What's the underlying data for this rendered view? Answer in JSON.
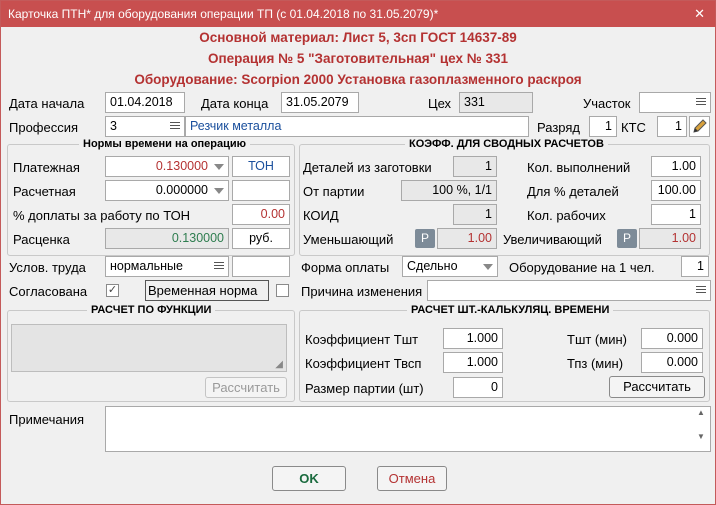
{
  "window": {
    "title": "Карточка ПТН* для оборудования операции ТП (с 01.04.2018 по 31.05.2079)*",
    "close_glyph": "✕"
  },
  "header": {
    "material": "Основной материал: Лист 5, 3сп ГОСТ 14637-89",
    "operation": "Операция № 5 \"Заготовительная\"  цех № 331",
    "equipment": "Оборудование: Scorpion 2000 Установка газоплазменного раскроя"
  },
  "fields": {
    "date_start_label": "Дата начала",
    "date_start": "01.04.2018",
    "date_end_label": "Дата конца",
    "date_end": "31.05.2079",
    "shop_label": "Цех",
    "shop": "331",
    "area_label": "Участок",
    "area": "",
    "profession_label": "Профессия",
    "profession_code": "3",
    "profession_name": "Резчик металла",
    "grade_label": "Разряд",
    "grade": "1",
    "kts_label": "КТС",
    "kts": "1"
  },
  "norms": {
    "title": "Нормы времени на операцию",
    "payable_label": "Платежная",
    "payable": "0.130000",
    "payable_unit": "ТОН",
    "calc_label": "Расчетная",
    "calc": "0.000000",
    "calc_unit": "",
    "ton_pct_label": "% доплаты за работу по ТОН",
    "ton_pct": "0.00",
    "rate_label": "Расценка",
    "rate": "0.130000",
    "rate_unit": "руб."
  },
  "coef": {
    "title": "КОЭФФ. ДЛЯ СВОДНЫХ РАСЧЕТОВ",
    "parts_label": "Деталей из заготовки",
    "parts": "1",
    "exec_label": "Кол. выполнений",
    "exec": "1.00",
    "batch_label": "От партии",
    "batch": "100 %, 1/1",
    "pct_label": "Для % деталей",
    "pct": "100.00",
    "koid_label": "КОИД",
    "koid": "1",
    "workers_label": "Кол. рабочих",
    "workers": "1",
    "dec_label": "Уменьшающий",
    "dec_badge": "Р",
    "dec": "1.00",
    "inc_label": "Увеличивающий",
    "inc_badge": "Р",
    "inc": "1.00"
  },
  "conditions": {
    "work_label": "Услов. труда",
    "work": "нормальные",
    "pay_form_label": "Форма оплаты",
    "pay_form": "Сдельно",
    "equip_per_label": "Оборудование на 1 чел.",
    "equip_per": "1",
    "agreed_label": "Согласована",
    "agreed_mark": "✓",
    "temp_label": "Временная норма",
    "reason_label": "Причина изменения",
    "reason": ""
  },
  "func_calc": {
    "title": "РАСЧЕТ ПО ФУНКЦИИ",
    "button": "Рассчитать"
  },
  "time_calc": {
    "title": "РАСЧЕТ ШТ.-КАЛЬКУЛЯЦ. ВРЕМЕНИ",
    "k_tsht_label": "Коэффициент Тшт",
    "k_tsht": "1.000",
    "tsht_label": "Тшт (мин)",
    "tsht": "0.000",
    "k_tvsp_label": "Коэффициент Твсп",
    "k_tvsp": "1.000",
    "tpz_label": "Тпз (мин)",
    "tpz": "0.000",
    "batch_size_label": "Размер партии (шт)",
    "batch_size": "0",
    "button": "Рассчитать"
  },
  "notes": {
    "label": "Примечания",
    "value": ""
  },
  "footer": {
    "ok": "OK",
    "cancel": "Отмена"
  },
  "colors": {
    "title_bar": "#c84f4f",
    "header_text": "#b43232",
    "accent_blue": "#1a4f9c"
  }
}
